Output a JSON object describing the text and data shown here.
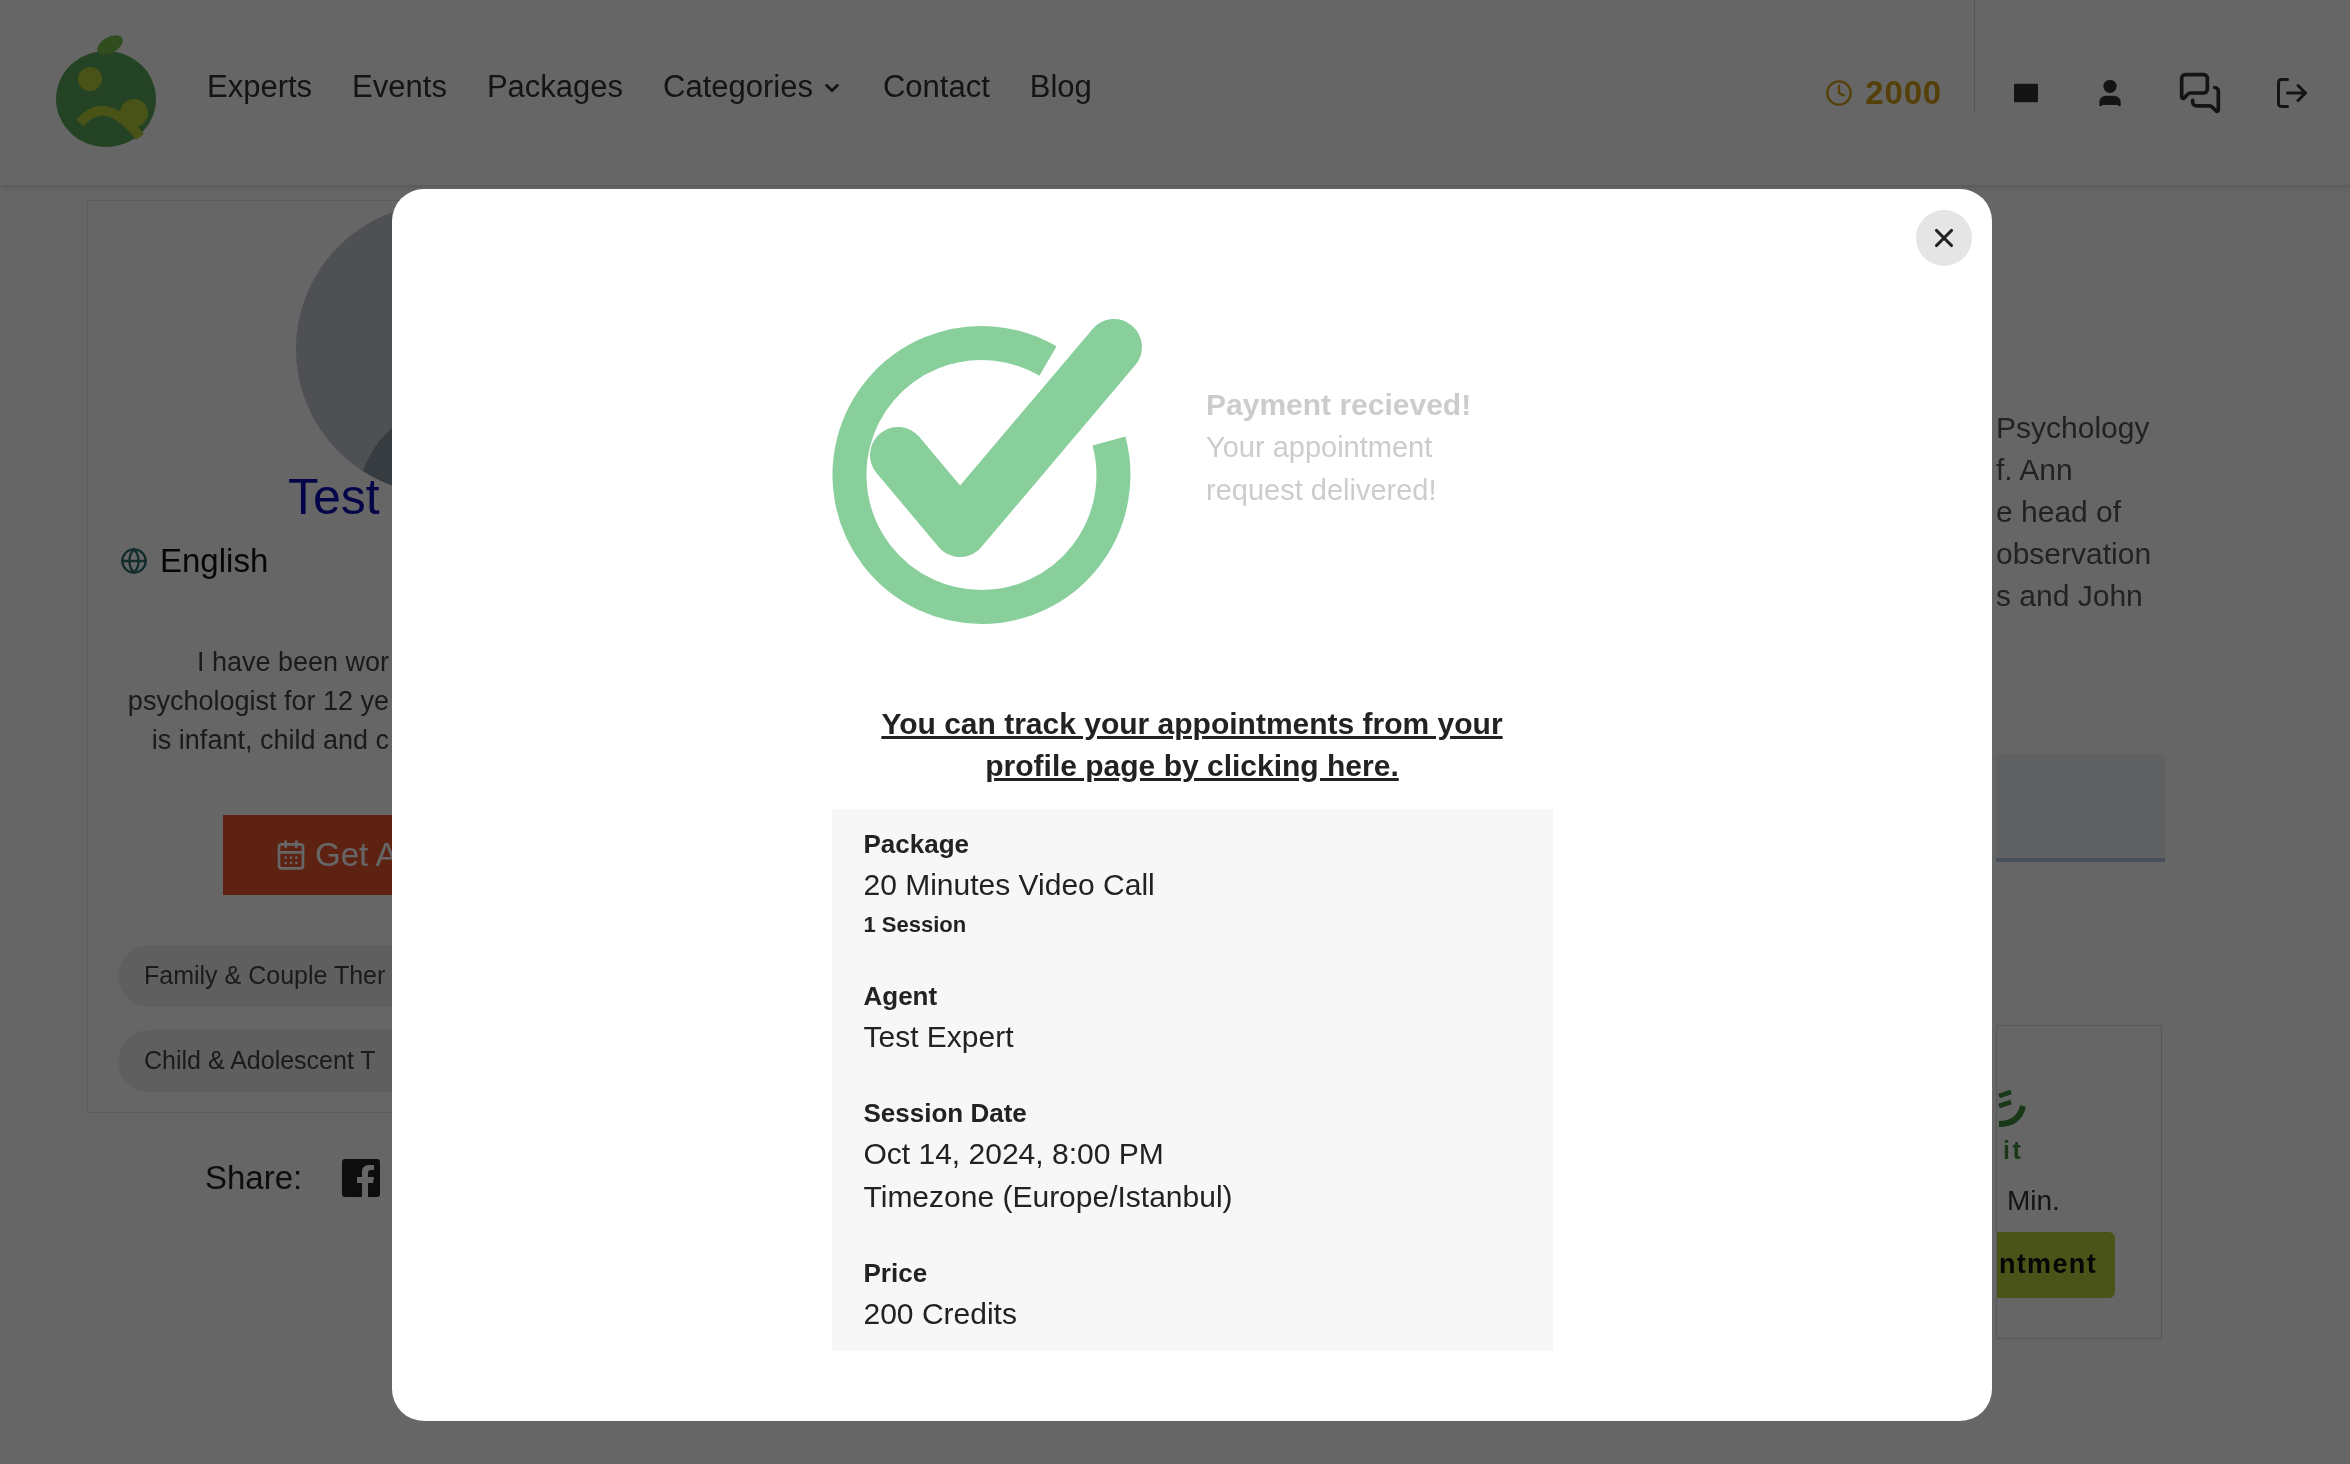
{
  "header": {
    "nav": [
      {
        "label": "Experts",
        "kind": "link"
      },
      {
        "label": "Events",
        "kind": "link"
      },
      {
        "label": "Packages",
        "kind": "link"
      },
      {
        "label": "Categories",
        "kind": "dropdown"
      },
      {
        "label": "Contact",
        "kind": "link"
      },
      {
        "label": "Blog",
        "kind": "link"
      }
    ],
    "credits": "2000"
  },
  "profile": {
    "name": "Test",
    "language": "English",
    "bio_lines": [
      "I have been wor",
      "psychologist for 12 ye",
      "is infant, child and c"
    ],
    "button": "Get A",
    "tags": [
      "Family & Couple Ther",
      "Child & Adolescent T"
    ],
    "share_label": "Share:"
  },
  "about_lines": [
    "Psychology",
    "f. Ann",
    "e head of",
    "observation",
    "s and John"
  ],
  "package_card": {
    "unit": "it",
    "duration": "Min.",
    "button": "ntment"
  },
  "modal": {
    "title": "Payment recieved!",
    "message": "Your appointment request delivered!",
    "link": "You can track your appointments from your profile page by clicking here.",
    "details": [
      {
        "label": "Package",
        "values": [
          "20 Minutes Video Call"
        ],
        "note": "1 Session"
      },
      {
        "label": "Agent",
        "values": [
          "Test Expert"
        ]
      },
      {
        "label": "Session Date",
        "values": [
          "Oct 14, 2024, 8:00 PM",
          "Timezone (Europe/Istanbul)"
        ]
      },
      {
        "label": "Price",
        "values": [
          "200 Credits"
        ]
      }
    ]
  }
}
